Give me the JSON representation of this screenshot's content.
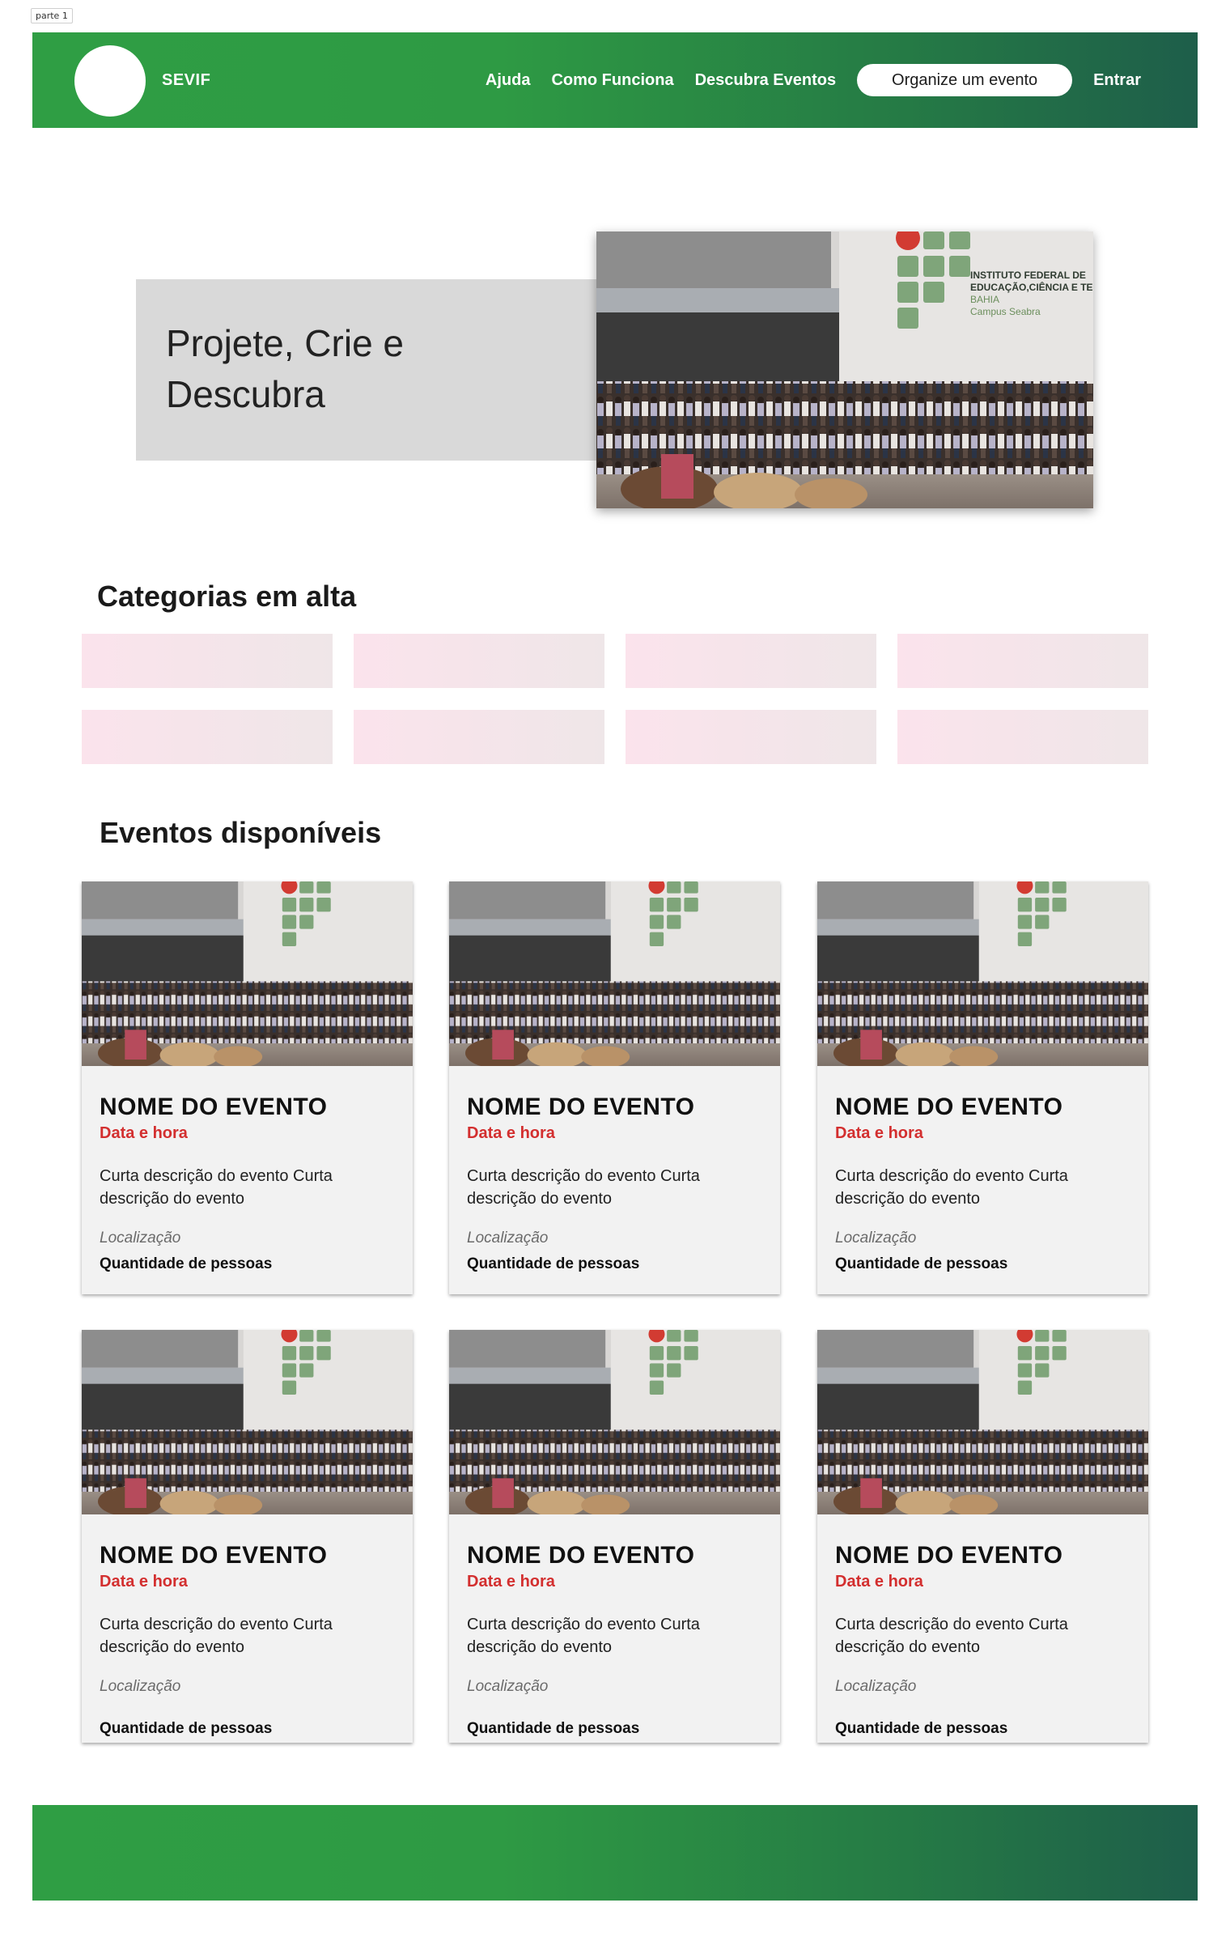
{
  "frame": {
    "label": "parte 1"
  },
  "header": {
    "brand": "SEVIF",
    "nav": [
      {
        "label": "Ajuda"
      },
      {
        "label": "Como Funciona"
      },
      {
        "label": "Descubra Eventos"
      }
    ],
    "cta_label": "Organize um evento",
    "login_label": "Entrar"
  },
  "hero": {
    "title": "Projete, Crie e Descubra",
    "photo_text": {
      "line1": "INSTITUTO FEDERAL DE",
      "line2": "EDUCAÇÃO,CIÊNCIA E TECNOLO",
      "line3": "BAHIA",
      "line4": "Campus Seabra"
    }
  },
  "categories": {
    "title": "Categorias em alta",
    "count": 8
  },
  "events": {
    "title": "Eventos disponíveis",
    "items": [
      {
        "name": "NOME DO EVENTO",
        "date": "Data e hora",
        "description": "Curta descrição do evento Curta descrição do evento",
        "location": "Localização",
        "capacity": "Quantidade de pessoas"
      },
      {
        "name": "NOME DO EVENTO",
        "date": "Data e hora",
        "description": "Curta descrição do evento Curta descrição do evento",
        "location": "Localização",
        "capacity": "Quantidade de pessoas"
      },
      {
        "name": "NOME DO EVENTO",
        "date": "Data e hora",
        "description": "Curta descrição do evento Curta descrição do evento",
        "location": "Localização",
        "capacity": "Quantidade de pessoas"
      },
      {
        "name": "NOME DO EVENTO",
        "date": "Data e hora",
        "description": "Curta descrição do evento Curta descrição do evento",
        "location": "Localização",
        "capacity": "Quantidade de pessoas"
      },
      {
        "name": "NOME DO EVENTO",
        "date": "Data e hora",
        "description": "Curta descrição do evento Curta descrição do evento",
        "location": "Localização",
        "capacity": "Quantidade de pessoas"
      },
      {
        "name": "NOME DO EVENTO",
        "date": "Data e hora",
        "description": "Curta descrição do evento Curta descrição do evento",
        "location": "Localização",
        "capacity": "Quantidade de pessoas"
      }
    ]
  },
  "colors": {
    "header_green": "#2f9e44",
    "header_dark": "#1e5e4a",
    "date_red": "#d32f2f",
    "card_bg": "#f2f2f2",
    "category_pink": "#fbe3ec"
  }
}
